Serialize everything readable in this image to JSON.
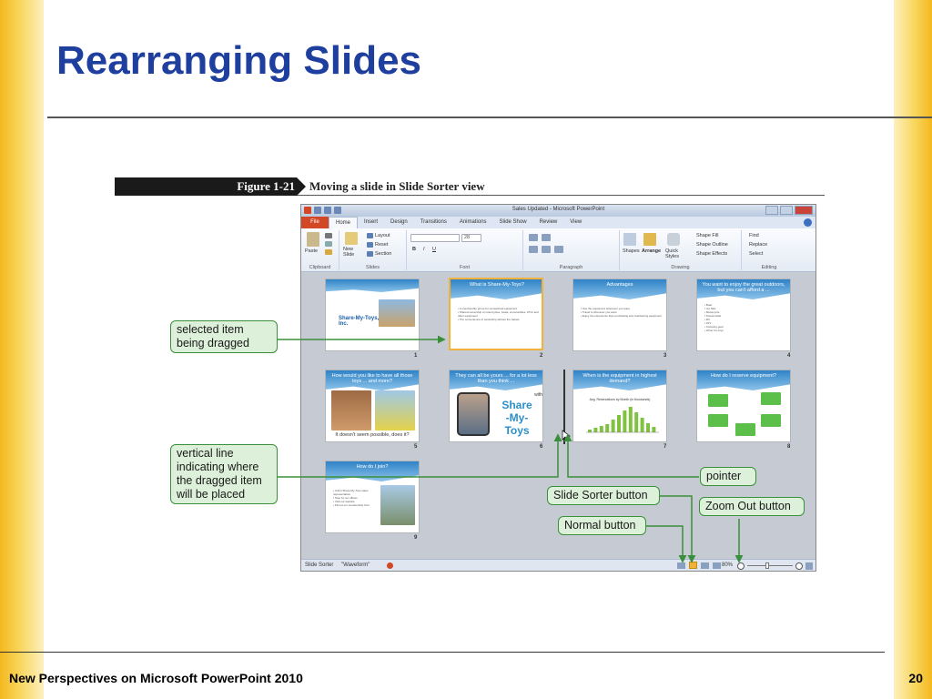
{
  "slide": {
    "title": "Rearranging Slides",
    "footer": "New Perspectives on Microsoft PowerPoint 2010",
    "page_number": "20"
  },
  "figure": {
    "label": "Figure 1-21",
    "caption": "Moving a slide in Slide Sorter view"
  },
  "window": {
    "title": "Sales Updated - Microsoft PowerPoint",
    "tabs": [
      "File",
      "Home",
      "Insert",
      "Design",
      "Transitions",
      "Animations",
      "Slide Show",
      "Review",
      "View"
    ],
    "active_tab": "Home"
  },
  "ribbon": {
    "clipboard": {
      "paste": "Paste",
      "label": "Clipboard"
    },
    "slides": {
      "new_slide": "New Slide",
      "layout": "Layout",
      "reset": "Reset",
      "section": "Section",
      "label": "Slides"
    },
    "font": {
      "size": "28",
      "label": "Font"
    },
    "paragraph": {
      "label": "Paragraph"
    },
    "drawing": {
      "shapes": "Shapes",
      "arrange": "Arrange",
      "quick_styles": "Quick Styles",
      "shape_fill": "Shape Fill",
      "shape_outline": "Shape Outline",
      "shape_effects": "Shape Effects",
      "label": "Drawing"
    },
    "editing": {
      "find": "Find",
      "replace": "Replace",
      "select": "Select",
      "label": "Editing"
    }
  },
  "slides": [
    {
      "num": "1",
      "title": "",
      "subtitle": "Share-My-Toys, Inc."
    },
    {
      "num": "2",
      "title": "What is Share-My-Toys?",
      "bullets": [
        "A membership group for recreational equipment",
        "Shared ownership of motorcycles, boats, snowmobiles, ATVs and other equipment",
        "The convenience of ownership without the hassle"
      ]
    },
    {
      "num": "3",
      "title": "Advantages",
      "bullets": [
        "Use the equipment whenever you want",
        "Travel to wherever you want",
        "Enjoy the experience than purchasing and maintaining equipment"
      ]
    },
    {
      "num": "4",
      "title": "You want to enjoy the great outdoors, but you can't afford a ...",
      "bullets": [
        "Boat",
        "Jet Skis",
        "Motorcycle",
        "Snowmobile",
        "RV",
        "ATV",
        "Camping gear",
        "Other fun toys"
      ]
    },
    {
      "num": "5",
      "title": "How would you like to have all those toys ... and more?",
      "caption": "It doesn't seem possible, does it?"
    },
    {
      "num": "6",
      "title": "They can all be yours ... for a lot less than you think ...",
      "logo_with": "with",
      "logo_lines": [
        "Share",
        "-My-",
        "Toys"
      ]
    },
    {
      "num": "7",
      "title": "When is the equipment in highest demand?",
      "chart_title": "Avg. Reservations by Month (in thousands)"
    },
    {
      "num": "8",
      "title": "How do I reserve equipment?"
    },
    {
      "num": "9",
      "title": "How do I join?",
      "bullets": [
        "Call a Share-My-Toys sales representative",
        "Stop by our offices",
        "Visit our website",
        "Fill out our membership form"
      ]
    }
  ],
  "statusbar": {
    "view": "Slide Sorter",
    "theme": "\"Waveform\"",
    "zoom": "80%"
  },
  "callouts": {
    "selected_item": "selected item being dragged",
    "vertical_line": "vertical line indicating where the dragged item will be placed",
    "pointer": "pointer",
    "slide_sorter_button": "Slide Sorter button",
    "normal_button": "Normal button",
    "zoom_out_button": "Zoom Out button"
  },
  "colors": {
    "title": "#1f3f9e",
    "callout_fill": "#ddf0da",
    "callout_border": "#3a8f3a",
    "selection": "#f2b23a",
    "accent_bar": "#f4b81e"
  }
}
